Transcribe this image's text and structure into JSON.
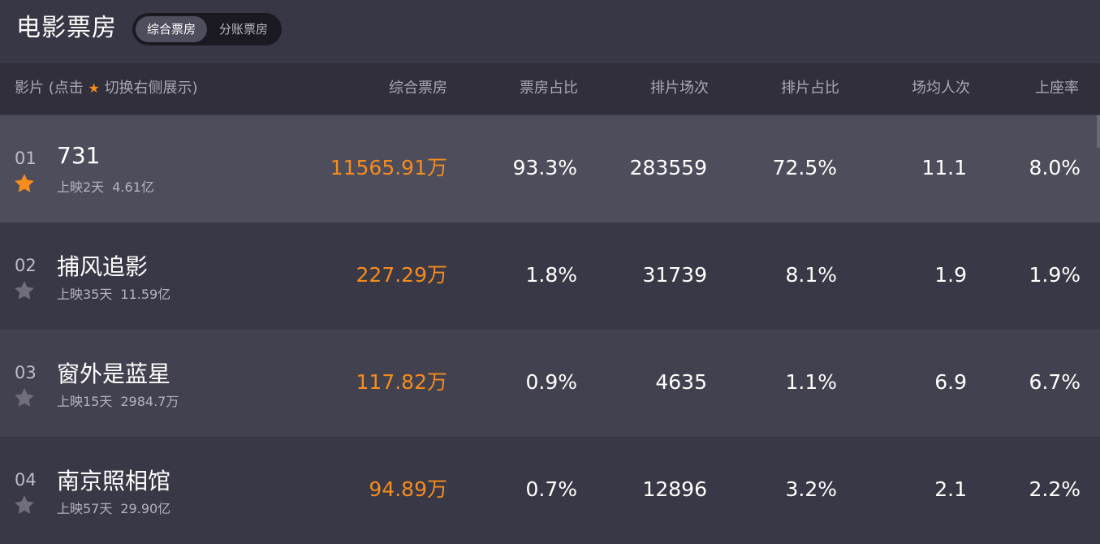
{
  "header": {
    "title": "电影票房",
    "toggle": [
      "综合票房",
      "分账票房"
    ],
    "active_toggle": 0
  },
  "columns": {
    "film": {
      "prefix": "影片 (点击",
      "suffix": "切换右侧展示)",
      "icon": "star-icon"
    },
    "box_office": "综合票房",
    "box_share": "票房占比",
    "shows": "排片场次",
    "show_share": "排片占比",
    "avg_people": "场均人次",
    "occupancy": "上座率"
  },
  "colors": {
    "accent": "#f58c1d",
    "star_active": "#f58c1d",
    "star_inactive": "#6f6e7a",
    "selected_row": "#4e4d5c"
  },
  "rows": [
    {
      "rank": "01",
      "name": "731",
      "days": "上映2天",
      "total": "4.61亿",
      "box_office": "11565.91万",
      "box_share": "93.3%",
      "shows": "283559",
      "show_share": "72.5%",
      "avg_people": "11.1",
      "occupancy": "8.0%",
      "starred": true
    },
    {
      "rank": "02",
      "name": "捕风追影",
      "days": "上映35天",
      "total": "11.59亿",
      "box_office": "227.29万",
      "box_share": "1.8%",
      "shows": "31739",
      "show_share": "8.1%",
      "avg_people": "1.9",
      "occupancy": "1.9%",
      "starred": false
    },
    {
      "rank": "03",
      "name": "窗外是蓝星",
      "days": "上映15天",
      "total": "2984.7万",
      "box_office": "117.82万",
      "box_share": "0.9%",
      "shows": "4635",
      "show_share": "1.1%",
      "avg_people": "6.9",
      "occupancy": "6.7%",
      "starred": false
    },
    {
      "rank": "04",
      "name": "南京照相馆",
      "days": "上映57天",
      "total": "29.90亿",
      "box_office": "94.89万",
      "box_share": "0.7%",
      "shows": "12896",
      "show_share": "3.2%",
      "avg_people": "2.1",
      "occupancy": "2.2%",
      "starred": false
    }
  ]
}
